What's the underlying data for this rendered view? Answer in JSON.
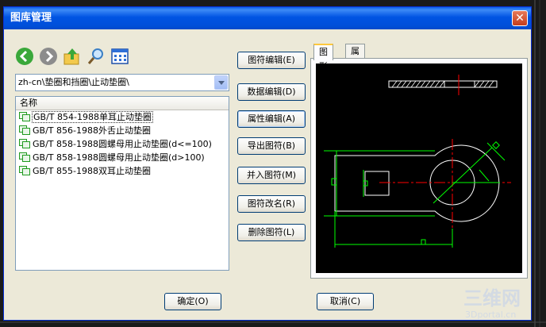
{
  "window": {
    "title": "图库管理",
    "close_glyph": "✕"
  },
  "toolbar": {
    "icons": [
      "back-arrow-icon",
      "forward-arrow-icon",
      "up-folder-icon",
      "search-magnifier-icon",
      "view-grid-icon"
    ]
  },
  "path_combo": {
    "value": "zh-cn\\垫圈和挡圈\\止动垫圈\\"
  },
  "list": {
    "header": "名称",
    "items": [
      {
        "label": "GB/T 854-1988单耳止动垫圈",
        "selected": true
      },
      {
        "label": "GB/T 856-1988外舌止动垫圈",
        "selected": false
      },
      {
        "label": "GB/T 858-1988圆螺母用止动垫圈(d<=100)",
        "selected": false
      },
      {
        "label": "GB/T 858-1988圆螺母用止动垫圈(d>100)",
        "selected": false
      },
      {
        "label": "GB/T 855-1988双耳止动垫圈",
        "selected": false
      }
    ]
  },
  "actions": {
    "edit_symbol": "图符编辑(E)",
    "edit_data": "数据编辑(D)",
    "edit_attr": "属性编辑(A)",
    "export": "导出图符(B)",
    "merge": "并入图符(M)",
    "rename": "图符改名(R)",
    "delete": "删除图符(L)"
  },
  "tabs": {
    "graphic": "图形",
    "attributes": "属性"
  },
  "footer": {
    "ok": "确定(O)",
    "cancel": "取消(C)"
  },
  "watermark": {
    "line1": "三维网",
    "line2": "3Dportal.cn"
  },
  "colors": {
    "cad_green": "#00ff00",
    "cad_red": "#ff0000",
    "cad_white": "#ffffff",
    "title_blue": "#0054e3"
  }
}
